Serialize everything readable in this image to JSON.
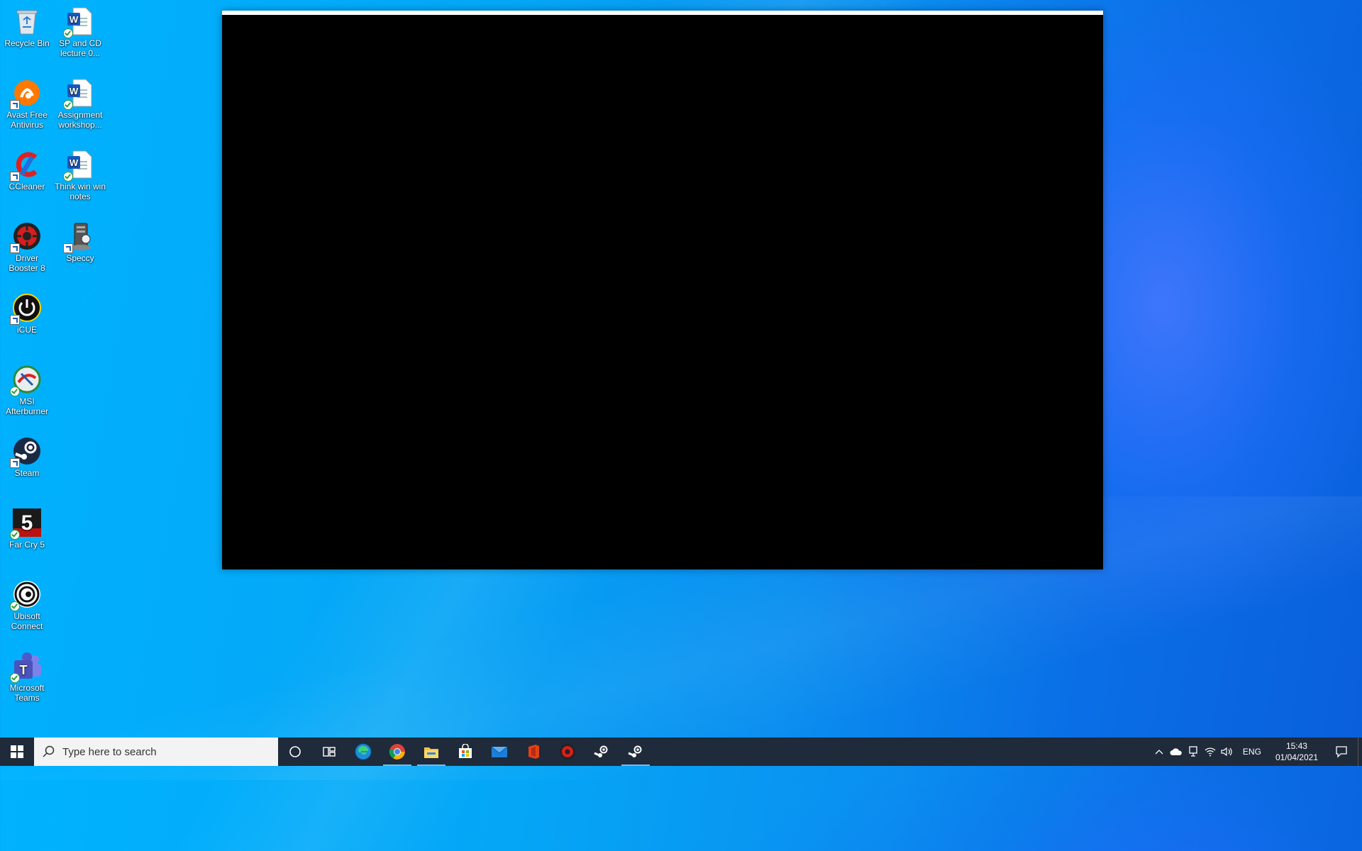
{
  "desktop": {
    "icons": [
      {
        "label": "Recycle Bin"
      },
      {
        "label": "SP and CD lecture 0..."
      },
      {
        "label": "Avast Free Antivirus"
      },
      {
        "label": "Assignment workshop..."
      },
      {
        "label": "CCleaner"
      },
      {
        "label": "Think win win notes"
      },
      {
        "label": "Driver Booster 8"
      },
      {
        "label": "Speccy"
      },
      {
        "label": "iCUE"
      },
      {
        "label": "MSI Afterburner"
      },
      {
        "label": "Steam"
      },
      {
        "label": "Far Cry 5"
      },
      {
        "label": "Ubisoft Connect"
      },
      {
        "label": "Microsoft Teams"
      }
    ]
  },
  "taskbar": {
    "search_placeholder": "Type here to search",
    "pinned": [
      {
        "name": "cortana-icon"
      },
      {
        "name": "task-view-icon"
      },
      {
        "name": "edge-icon"
      },
      {
        "name": "chrome-icon"
      },
      {
        "name": "file-explorer-icon"
      },
      {
        "name": "store-icon"
      },
      {
        "name": "mail-icon"
      },
      {
        "name": "office-icon"
      },
      {
        "name": "driver-booster-icon"
      },
      {
        "name": "steam-icon"
      },
      {
        "name": "steam-icon-active"
      }
    ],
    "tray": {
      "language": "ENG",
      "time": "15:43",
      "date": "01/04/2021"
    }
  },
  "colors": {
    "taskbar_bg": "#1f2a3a",
    "active_indicator": "#76b9ed",
    "desktop_blue": "#0a8ff0"
  }
}
